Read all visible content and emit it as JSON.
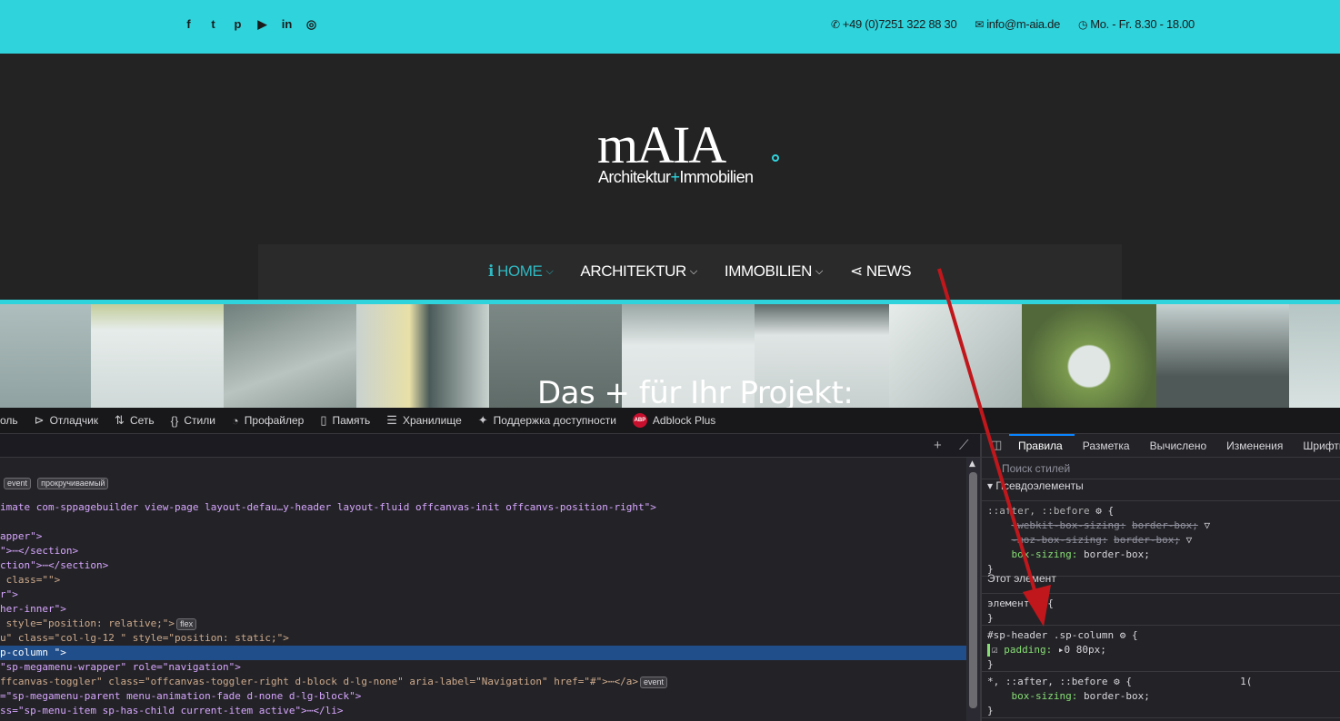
{
  "topbar": {
    "social_icons": [
      "facebook-icon",
      "twitter-icon",
      "pinterest-icon",
      "youtube-icon",
      "linkedin-icon",
      "instagram-icon"
    ],
    "social_glyphs": [
      "f",
      "t",
      "p",
      "▶",
      "in",
      "◎"
    ],
    "phone": "+49 (0)7251 322 88 30",
    "email": "info@m-aia.de",
    "hours": "Mo. - Fr. 8.30 - 18.00",
    "bg_color": "#2fd3dc"
  },
  "logo": {
    "main": "mAIA",
    "sub_left": "Architektur",
    "sub_plus": "+",
    "sub_right": "Immobilien"
  },
  "nav": {
    "items": [
      {
        "label": "HOME",
        "icon": "info-icon",
        "glyph": "ℹ",
        "dropdown": true,
        "active": true
      },
      {
        "label": "ARCHITEKTUR",
        "dropdown": true
      },
      {
        "label": "IMMOBILIEN",
        "dropdown": true
      },
      {
        "label": "NEWS",
        "icon": "share-icon",
        "glyph": "⋖"
      }
    ],
    "active_color": "#2fb9c2"
  },
  "banner": {
    "title": "Das + für Ihr Projekt:"
  },
  "devtools": {
    "tabs": [
      {
        "label": "оль",
        "icon": ""
      },
      {
        "label": "Отладчик",
        "icon": "debugger-icon",
        "glyph": "⊳"
      },
      {
        "label": "Сеть",
        "icon": "network-icon",
        "glyph": "⇅"
      },
      {
        "label": "Стили",
        "icon": "styles-icon",
        "glyph": "{}"
      },
      {
        "label": "Профайлер",
        "icon": "profiler-icon",
        "glyph": "◔"
      },
      {
        "label": "Память",
        "icon": "memory-icon",
        "glyph": "▯"
      },
      {
        "label": "Хранилище",
        "icon": "storage-icon",
        "glyph": "☰"
      },
      {
        "label": "Поддержка доступности",
        "icon": "accessibility-icon",
        "glyph": "✦"
      },
      {
        "label": "Adblock Plus",
        "icon": "adblock-icon",
        "glyph": "ABP"
      }
    ],
    "markup": {
      "badges_line": {
        "b1": "event",
        "b2": "прокручиваемый"
      },
      "lines": [
        {
          "text": "imate com-sppagebuilder view-page layout-defau…y-header layout-fluid offcanvas-init offcanvs-position-right\">"
        },
        {
          "text": ""
        },
        {
          "text": "apper\">"
        },
        {
          "text": "\">⋯</section>"
        },
        {
          "text": "ction\">⋯</section>"
        },
        {
          "text": " class=\"\">"
        },
        {
          "text": "r\">"
        },
        {
          "text": "her-inner\">"
        },
        {
          "text": " style=\"position: relative;\">",
          "badge": "flex"
        },
        {
          "text": "u\" class=\"col-lg-12 \" style=\"position: static;\">"
        },
        {
          "text": "p-column \">",
          "selected": true
        },
        {
          "text": "\"sp-megamenu-wrapper\" role=\"navigation\">"
        },
        {
          "text": "ffcanvas-toggler\" class=\"offcanvas-toggler-right d-block d-lg-none\" aria-label=\"Navigation\" href=\"#\">⋯</a>",
          "badge": "event"
        },
        {
          "text": "=\"sp-megamenu-parent menu-animation-fade d-none d-lg-block\">"
        },
        {
          "text": "ss=\"sp-menu-item sp-has-child current-item active\">⋯</li>"
        }
      ]
    },
    "rules": {
      "tabs": [
        "Правила",
        "Разметка",
        "Вычислено",
        "Изменения",
        "Шрифты"
      ],
      "filter_placeholder": "Поиск стилей",
      "pseudo_header": "Псевдоэлементы",
      "pseudo_selector": "::after, ::before",
      "pseudo_lines": [
        {
          "prop": "-webkit-box-sizing:",
          "val": "border-box;",
          "struck": true
        },
        {
          "prop": "-moz-box-sizing:",
          "val": "border-box;",
          "struck": true
        },
        {
          "prop": "box-sizing:",
          "val": "border-box;",
          "struck": false
        }
      ],
      "this_element_header": "Этот элемент",
      "element_selector": "элемент",
      "rule1_selector": "#sp-header .sp-column",
      "rule1_prop": "padding:",
      "rule1_val": "0 80px;",
      "rule2_selector": "*, ::after, ::before",
      "rule2_prop": "box-sizing:",
      "rule2_val": "border-box;",
      "rule3_selector": "*",
      "line_no": "1("
    }
  },
  "annotation": {
    "arrow_color": "#c0171c"
  }
}
